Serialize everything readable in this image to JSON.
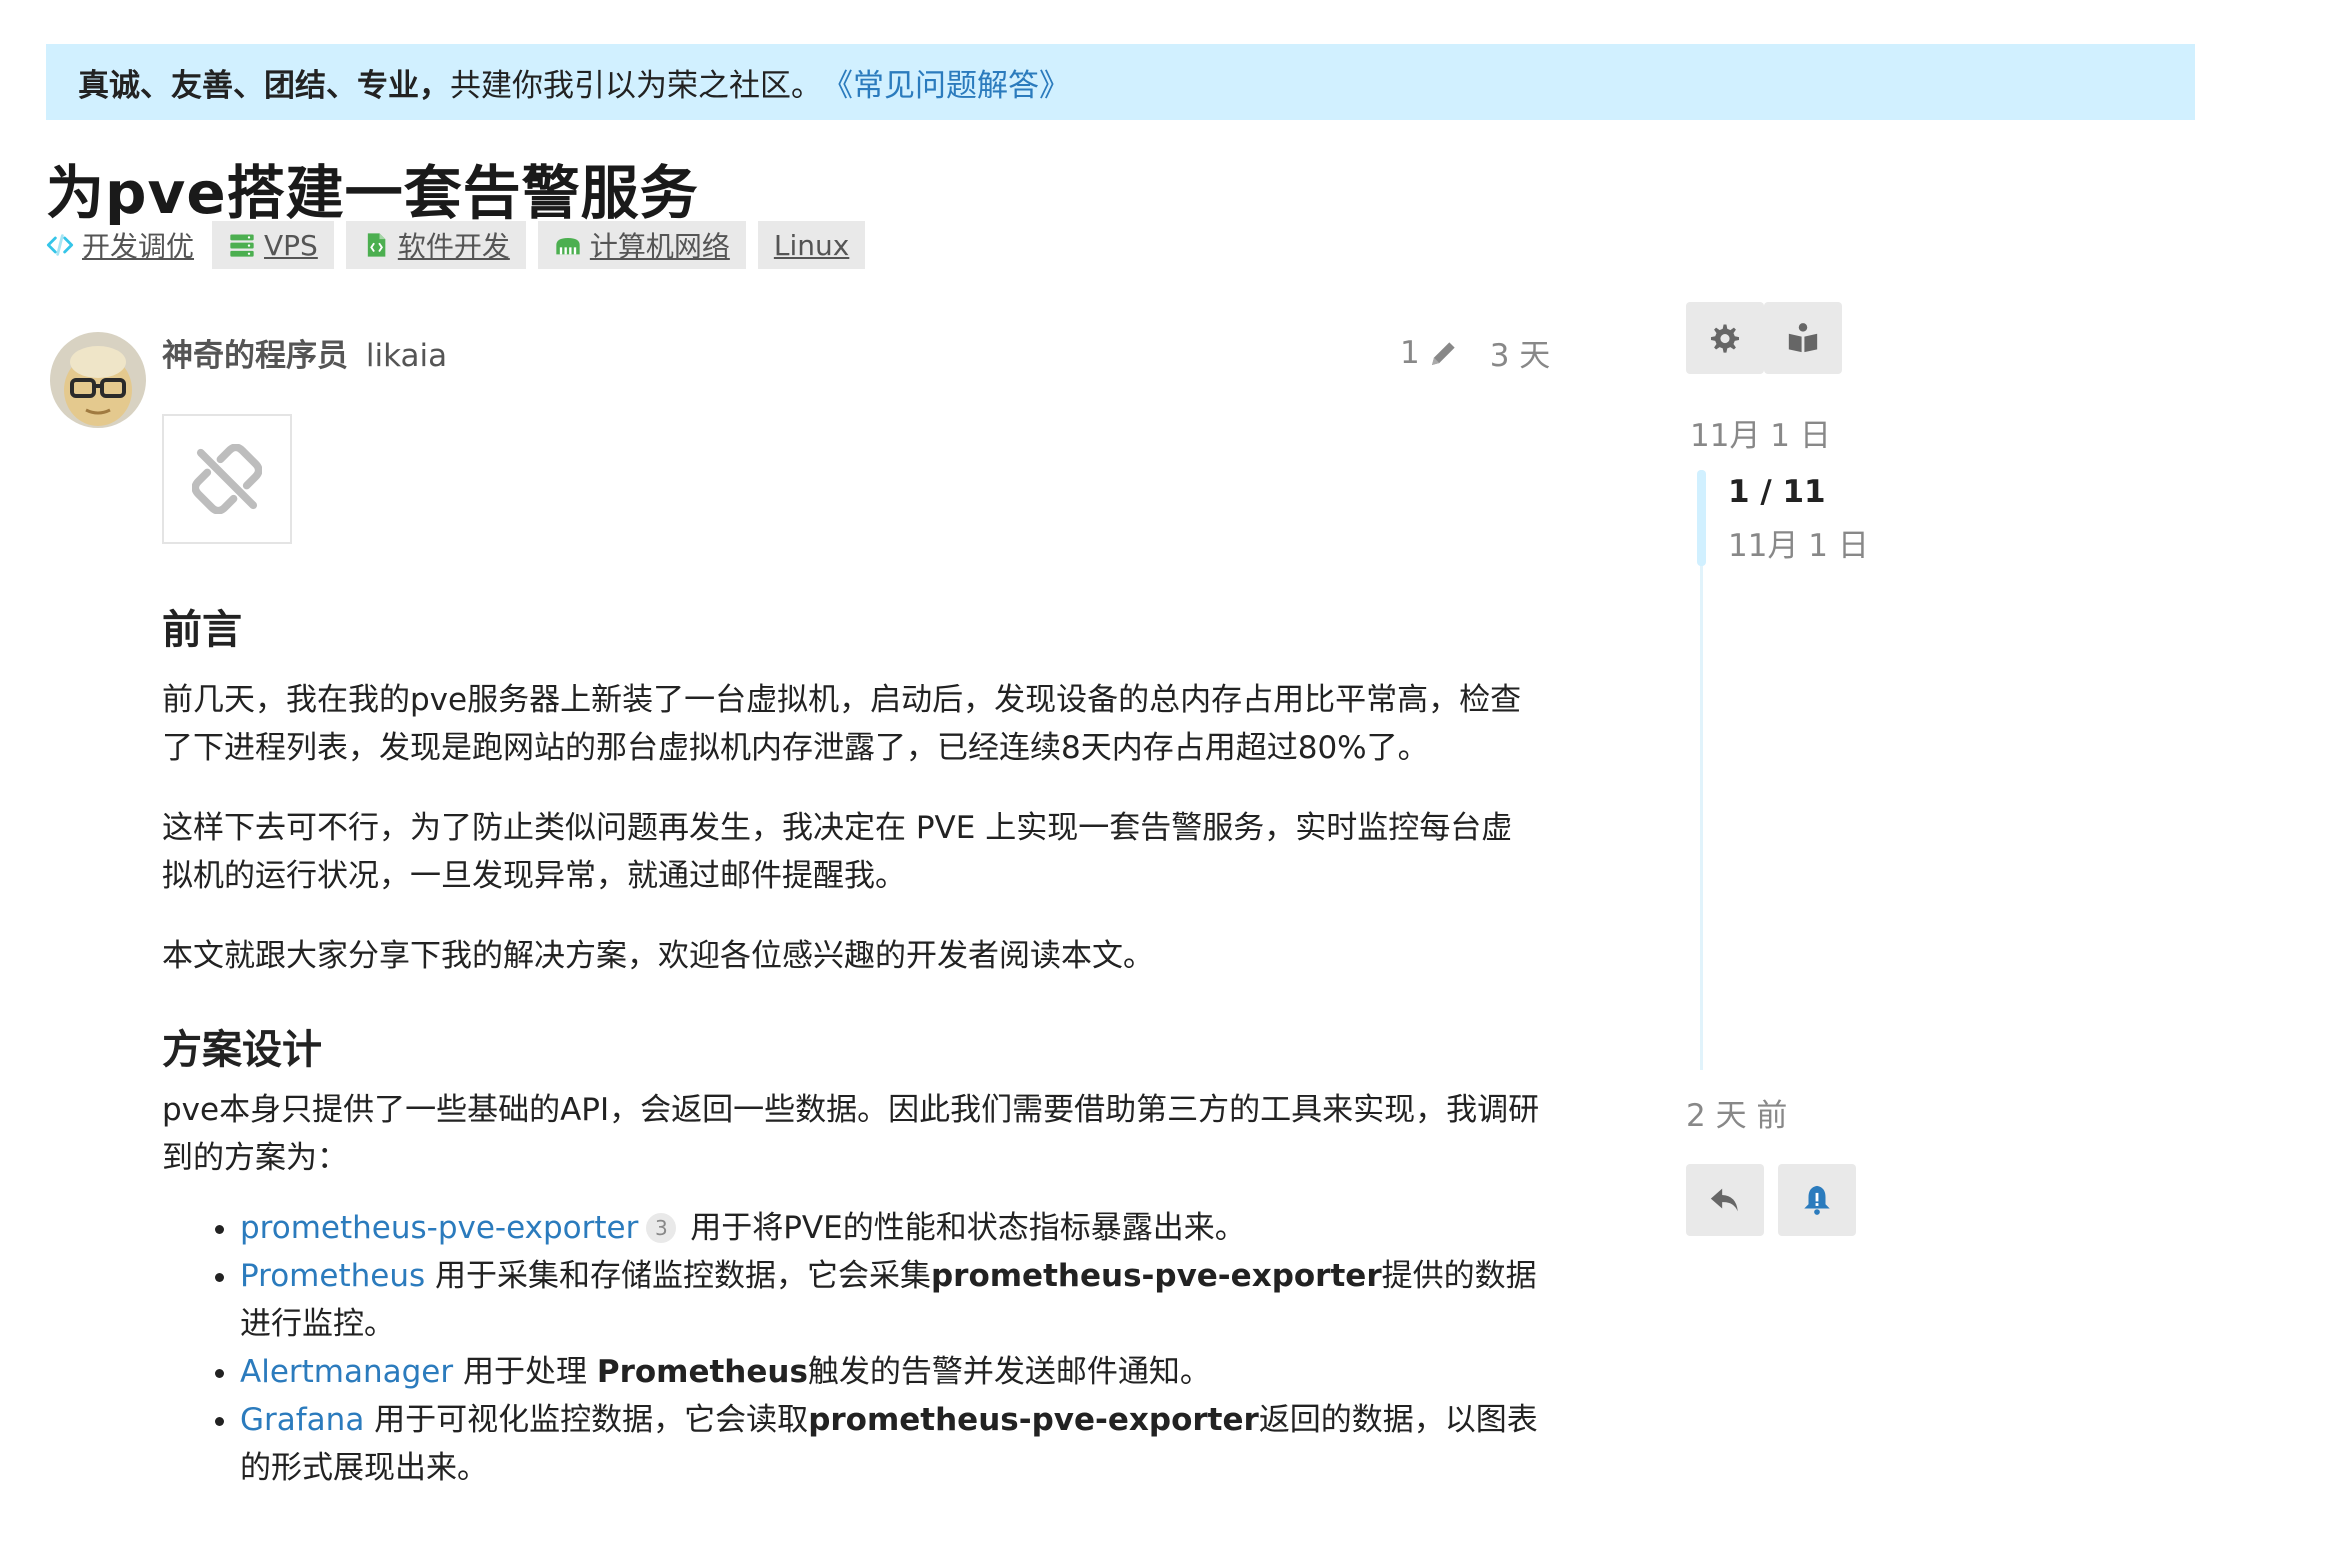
{
  "banner": {
    "strong_text": "真诚、友善、团结、专业，",
    "plain_text": "共建你我引以为荣之社区。",
    "link_text": "《常见问题解答》"
  },
  "topic": {
    "title": "为pve搭建一套告警服务",
    "category": {
      "name": "开发调优",
      "icon": "code-icon",
      "color": "#35c5e8"
    },
    "tags": [
      {
        "name": "VPS",
        "icon": "server-icon",
        "color": "#4caf50"
      },
      {
        "name": "软件开发",
        "icon": "code-file-icon",
        "color": "#4caf50"
      },
      {
        "name": "计算机网络",
        "icon": "network-icon",
        "color": "#4caf50"
      },
      {
        "name": "Linux",
        "icon": "",
        "color": ""
      }
    ]
  },
  "post": {
    "author_fullname": "神奇的程序员",
    "author_username": "likaia",
    "edit_count": "1",
    "age": "3 天",
    "sections": [
      {
        "heading": "前言",
        "paragraphs": [
          "前几天，我在我的pve服务器上新装了一台虚拟机，启动后，发现设备的总内存占用比平常高，检查了下进程列表，发现是跑网站的那台虚拟机内存泄露了，已经连续8天内存占用超过80%了。",
          "这样下去可不行，为了防止类似问题再发生，我决定在 PVE 上实现一套告警服务，实时监控每台虚拟机的运行状况，一旦发现异常，就通过邮件提醒我。",
          "本文就跟大家分享下我的解决方案，欢迎各位感兴趣的开发者阅读本文。"
        ]
      },
      {
        "heading": "方案设计",
        "paragraphs": [
          "pve本身只提供了一些基础的API，会返回一些数据。因此我们需要借助第三方的工具来实现，我调研到的方案为："
        ]
      }
    ],
    "list": [
      {
        "link": "prometheus-pve-exporter",
        "badge": "3",
        "parts": [
          {
            "t": " 用于将PVE的性能和状态指标暴露出来。",
            "b": false
          }
        ]
      },
      {
        "link": "Prometheus",
        "badge": "",
        "parts": [
          {
            "t": " 用于采集和存储监控数据，它会采集",
            "b": false
          },
          {
            "t": "prometheus-pve-exporter",
            "b": true
          },
          {
            "t": "提供的数据进行监控。",
            "b": false
          }
        ]
      },
      {
        "link": "Alertmanager",
        "badge": "",
        "parts": [
          {
            "t": " 用于处理 ",
            "b": false
          },
          {
            "t": "Prometheus",
            "b": true
          },
          {
            "t": "触发的告警并发送邮件通知。",
            "b": false
          }
        ]
      },
      {
        "link": "Grafana",
        "badge": "",
        "parts": [
          {
            "t": " 用于可视化监控数据，它会读取",
            "b": false
          },
          {
            "t": "prometheus-pve-exporter",
            "b": true
          },
          {
            "t": "返回的数据，以图表的形式展现出来。",
            "b": false
          }
        ]
      }
    ]
  },
  "timeline": {
    "start_date": "11月 1 日",
    "position": "1 / 11",
    "position_date": "11月 1 日",
    "end_label": "2 天 前"
  },
  "colors": {
    "banner_bg": "#d1f0ff",
    "link": "#2b7bbd",
    "tag_bg": "#e9e9e9",
    "tag_icon": "#4caf50",
    "category_icon": "#35c5e8",
    "bell": "#2b7bbd"
  }
}
